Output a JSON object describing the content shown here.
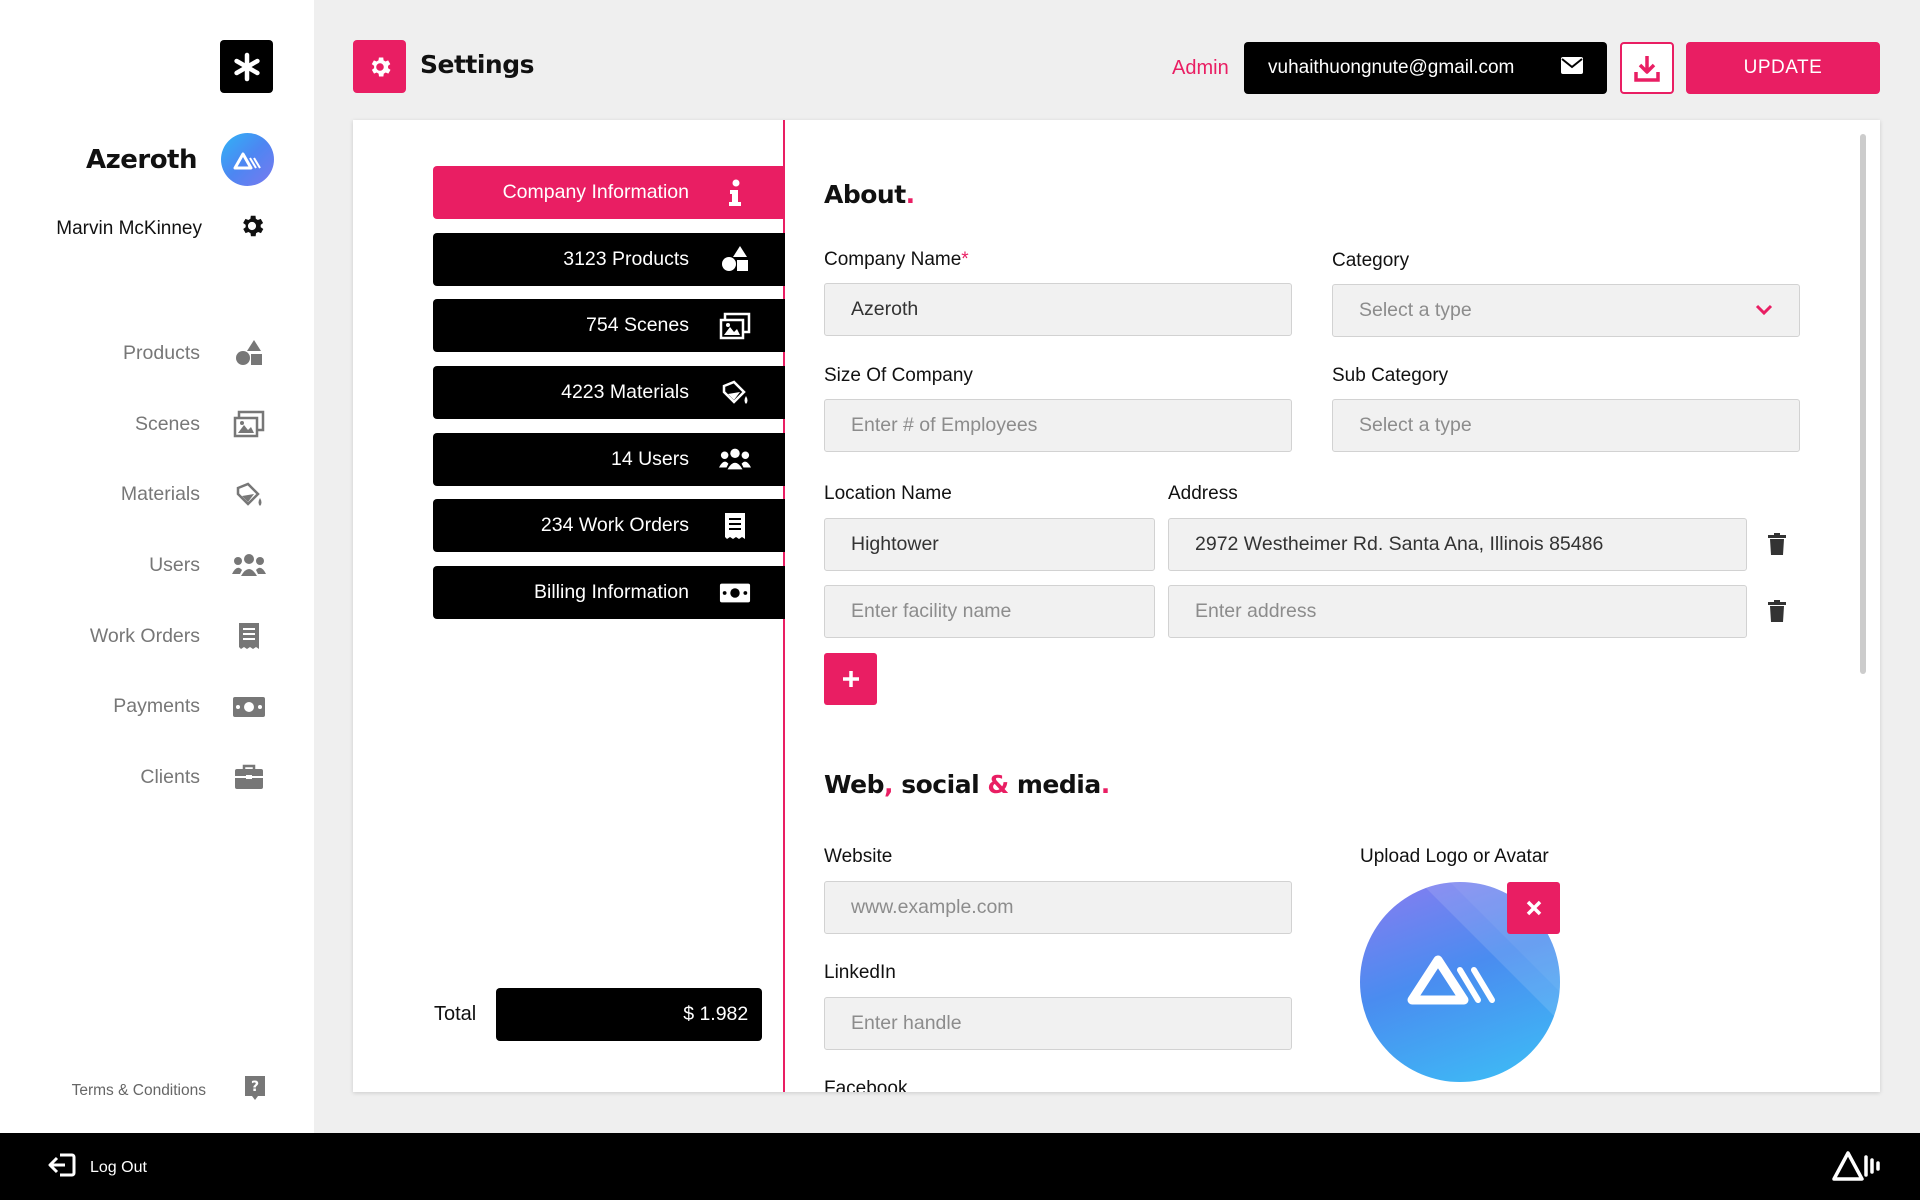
{
  "sidebar": {
    "company_name": "Azeroth",
    "user_name": "Marvin McKinney",
    "nav": [
      {
        "label": "Products",
        "icon": "shapes-icon"
      },
      {
        "label": "Scenes",
        "icon": "scenes-icon"
      },
      {
        "label": "Materials",
        "icon": "paint-bucket-icon"
      },
      {
        "label": "Users",
        "icon": "users-icon"
      },
      {
        "label": "Work Orders",
        "icon": "receipt-icon"
      },
      {
        "label": "Payments",
        "icon": "money-icon"
      },
      {
        "label": "Clients",
        "icon": "briefcase-icon"
      }
    ],
    "terms_label": "Terms & Conditions"
  },
  "footer": {
    "logout_label": "Log Out"
  },
  "header": {
    "title": "Settings",
    "role": "Admin",
    "email": "vuhaithuongnute@gmail.com",
    "update_label": "UPDATE"
  },
  "menu": {
    "items": [
      {
        "label": "Company Information",
        "icon": "info-icon",
        "active": true
      },
      {
        "label": "3123 Products",
        "icon": "shapes-icon"
      },
      {
        "label": "754 Scenes",
        "icon": "scenes-icon"
      },
      {
        "label": "4223 Materials",
        "icon": "paint-bucket-icon"
      },
      {
        "label": "14 Users",
        "icon": "users-icon"
      },
      {
        "label": "234 Work Orders",
        "icon": "receipt-icon"
      },
      {
        "label": "Billing Information",
        "icon": "money-icon"
      }
    ],
    "total_label": "Total",
    "total_value": "$ 1.982"
  },
  "about": {
    "title": "About",
    "dot": ".",
    "company_name_label": "Company Name",
    "required_mark": "*",
    "company_name_value": "Azeroth",
    "category_label": "Category",
    "category_placeholder": "Select a type",
    "size_label": "Size Of Company",
    "size_placeholder": "Enter # of Employees",
    "subcategory_label": "Sub Category",
    "subcategory_placeholder": "Select a type",
    "location_label": "Location Name",
    "address_label": "Address",
    "locations": [
      {
        "name": "Hightower",
        "address": "2972 Westheimer Rd. Santa Ana, Illinois 85486"
      }
    ],
    "facility_placeholder": "Enter facility name",
    "address_placeholder": "Enter address",
    "add_label": "+"
  },
  "web": {
    "title_part1": "Web",
    "comma": ",",
    "title_part2": " social ",
    "amp": "&",
    "title_part3": " media",
    "dot": ".",
    "website_label": "Website",
    "website_placeholder": "www.example.com",
    "linkedin_label": "LinkedIn",
    "linkedin_placeholder": "Enter handle",
    "facebook_label": "Facebook",
    "upload_label": "Upload Logo or Avatar"
  },
  "colors": {
    "accent": "#e91e63",
    "dark": "#000000",
    "field_bg": "#f1f1f1"
  }
}
